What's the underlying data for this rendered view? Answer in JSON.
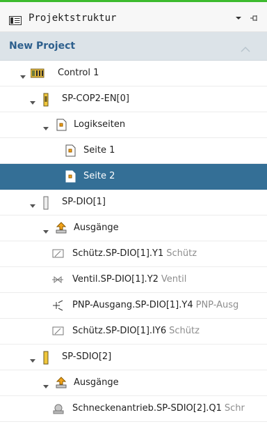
{
  "panel": {
    "title": "Projektstruktur"
  },
  "project": {
    "name": "New Project"
  },
  "tree": {
    "control": {
      "label": "Control 1"
    },
    "sp_cop2": {
      "label": "SP-COP2-EN[0]"
    },
    "logikseiten": {
      "label": "Logikseiten"
    },
    "seite1": {
      "label": "Seite 1"
    },
    "seite2": {
      "label": "Seite 2"
    },
    "sp_dio": {
      "label": "SP-DIO[1]"
    },
    "ausgaenge1": {
      "label": "Ausgänge"
    },
    "schuetz1": {
      "label": "Schütz.SP-DIO[1].Y1",
      "hint": "Schütz"
    },
    "ventil": {
      "label": "Ventil.SP-DIO[1].Y2",
      "hint": "Ventil"
    },
    "pnp": {
      "label": "PNP-Ausgang.SP-DIO[1].Y4",
      "hint": "PNP-Ausg"
    },
    "schuetz2": {
      "label": "Schütz.SP-DIO[1].IY6",
      "hint": "Schütz"
    },
    "sp_sdio": {
      "label": "SP-SDIO[2]"
    },
    "ausgaenge2": {
      "label": "Ausgänge"
    },
    "schnecke": {
      "label": "Schneckenantrieb.SP-SDIO[2].Q1",
      "hint": "Schr"
    }
  },
  "colors": {
    "accent": "#3dbb2e",
    "selected": "#346f96",
    "projectBar": "#dce3e8",
    "projectText": "#2d5f8d"
  }
}
